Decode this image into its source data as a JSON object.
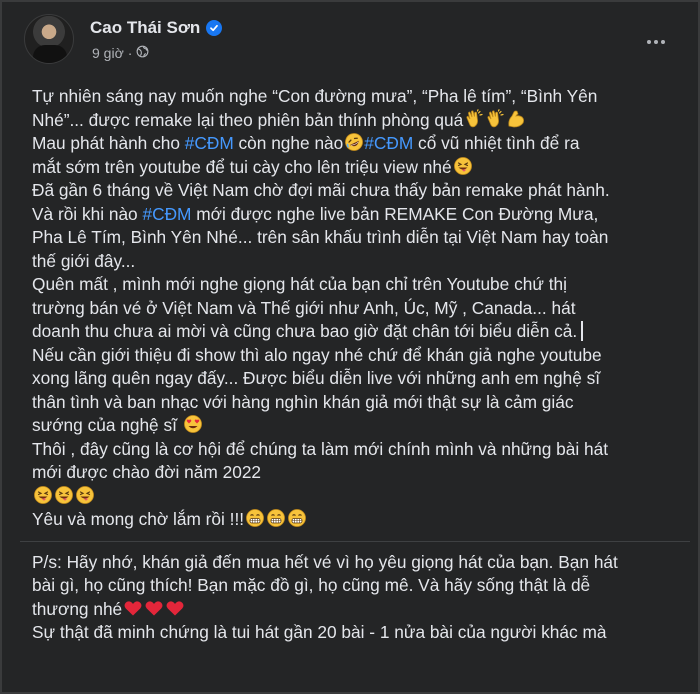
{
  "post": {
    "author": "Cao Thái Sơn",
    "time": "9 giờ",
    "icons": {
      "verified": "verified-badge-icon",
      "audience": "globe-icon",
      "menu": "more-options-icon"
    }
  },
  "lines": {
    "l1": "Tự nhiên sáng nay muốn nghe “Con đường mưa”, “Pha lê tím”, “Bình Yên",
    "l2": "Nhé”... được remake lại theo phiên bản thính phòng quá",
    "l3a": "Mau phát hành cho ",
    "l3tag1": "#CĐM",
    "l3b": " còn nghe nào",
    "l3tag2": "#CĐM",
    "l3c": " cổ vũ nhiệt tình để ra",
    "l4": "mắt sớm trên youtube để tui cày cho lên triệu view nhé",
    "l5": "Đã gần 6 tháng về Việt Nam chờ đợi mãi chưa thấy bản remake phát hành.",
    "l6a": "Và rồi khi nào ",
    "l6tag": "#CĐM",
    "l6b": " mới được nghe live bản REMAKE Con Đường Mưa,",
    "l7": "Pha Lê Tím, Bình Yên Nhé... trên sân khấu trình diễn tại Việt Nam hay toàn",
    "l8": "thế giới đây...",
    "l9": "Quên mất , mình mới nghe giọng hát của bạn chỉ trên Youtube chứ thị",
    "l10": "trường bán vé ở Việt Nam và Thế giới như Anh, Úc, Mỹ , Canada... hát",
    "l11": "doanh thu chưa ai mời và cũng chưa bao giờ đặt chân tới biểu diễn cả.",
    "l12": "Nếu cần giới thiệu đi show thì alo ngay nhé chứ để khán giả nghe youtube",
    "l13": "xong lãng quên ngay đấy... Được biểu diễn live với những anh em nghệ sĩ",
    "l14": "thân tình và ban nhạc với hàng nghìn khán giả mới thật sự là cảm giác",
    "l15": "sướng của nghệ sĩ",
    "l16": "Thôi , đây cũng là cơ hội để chúng ta làm mới chính mình và những bài hát",
    "l17": "mới được chào đời năm 2022",
    "l19": "Yêu và mong chờ lắm rồi !!!",
    "l20": "P/s: Hãy nhớ, khán giả đến mua hết vé vì họ yêu giọng hát của bạn. Bạn hát",
    "l21": "bài gì, họ cũng thích! Bạn mặc đồ gì, họ cũng mê. Và hãy sống thật là dễ",
    "l22": "thương nhé",
    "l23": "Sự thật đã minh chứng là tui hát gần 20 bài - 1 nửa bài của người khác mà"
  },
  "emoji_names": [
    "clapping-hands-icon",
    "flexed-biceps-icon",
    "rolling-laughing-face-icon",
    "winking-tongue-face-icon",
    "heart-eyes-face-icon",
    "grimacing-face-icon",
    "red-heart-icon"
  ]
}
